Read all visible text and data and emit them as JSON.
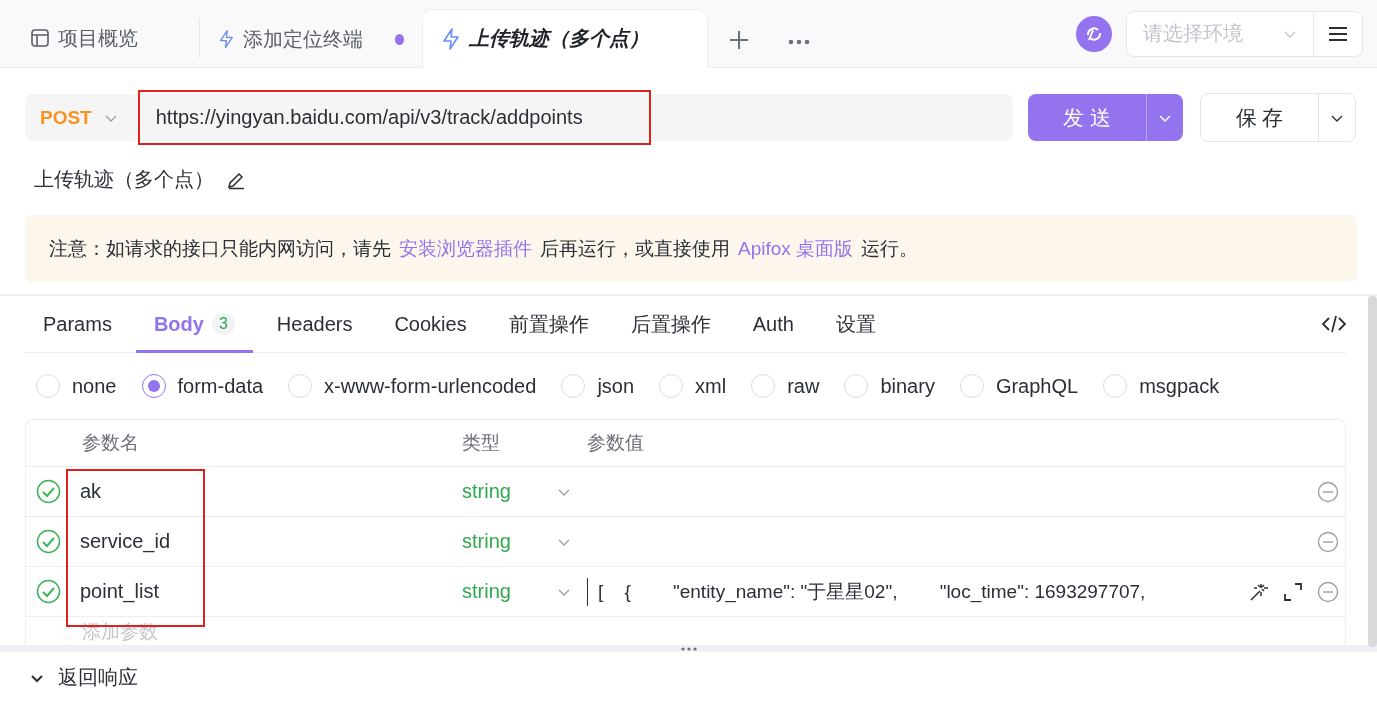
{
  "tabs": [
    {
      "kind": "overview",
      "label": "项目概览",
      "selected": false,
      "modified": false
    },
    {
      "kind": "api",
      "label": "添加定位终端",
      "selected": false,
      "modified": true
    },
    {
      "kind": "api",
      "label": "上传轨迹（多个点）",
      "selected": true,
      "modified": false
    }
  ],
  "environment": {
    "placeholder": "请选择环境"
  },
  "request": {
    "method": "POST",
    "url": "https://yingyan.baidu.com/api/v3/track/addpoints",
    "send": "发 送",
    "save": "保 存"
  },
  "name": "上传轨迹（多个点）",
  "notice": {
    "text_1": "注意：如请求的接口只能内网访问，请先",
    "link_1": "安装浏览器插件",
    "text_2": "后再运行，或直接使用",
    "link_2": "Apifox 桌面版",
    "text_3": "运行。"
  },
  "sub_tabs": [
    {
      "label": "Params",
      "selected": false
    },
    {
      "label": "Body",
      "badge": "3",
      "selected": true
    },
    {
      "label": "Headers",
      "selected": false
    },
    {
      "label": "Cookies",
      "selected": false
    },
    {
      "label": "前置操作",
      "selected": false
    },
    {
      "label": "后置操作",
      "selected": false
    },
    {
      "label": "Auth",
      "selected": false
    },
    {
      "label": "设置",
      "selected": false
    }
  ],
  "body_types": [
    {
      "label": "none",
      "selected": false
    },
    {
      "label": "form-data",
      "selected": true
    },
    {
      "label": "x-www-form-urlencoded",
      "selected": false
    },
    {
      "label": "json",
      "selected": false
    },
    {
      "label": "xml",
      "selected": false
    },
    {
      "label": "raw",
      "selected": false
    },
    {
      "label": "binary",
      "selected": false
    },
    {
      "label": "GraphQL",
      "selected": false
    },
    {
      "label": "msgpack",
      "selected": false
    }
  ],
  "table": {
    "columns": [
      "参数名",
      "类型",
      "参数值"
    ],
    "rows": [
      {
        "enabled": true,
        "name": "ak",
        "type": "string"
      },
      {
        "enabled": true,
        "name": "service_id",
        "type": "string"
      },
      {
        "enabled": true,
        "name": "point_list",
        "type": "string",
        "value": "[    {        \"entity_name\": \"于星星02\",        \"loc_time\": 1693297707,",
        "editing": true
      }
    ],
    "add_placeholder": "添加参数"
  },
  "response": {
    "label": "返回响应",
    "expanded": false
  }
}
